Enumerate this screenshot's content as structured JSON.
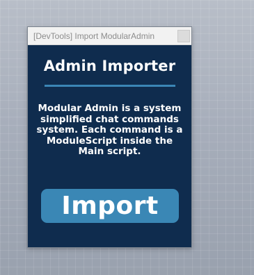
{
  "window": {
    "title": "[DevTools] Import ModularAdmin"
  },
  "plugin": {
    "heading": "Admin Importer",
    "description": "Modular Admin is a system simplified chat commands system. Each command is a ModuleScript inside the Main script.",
    "import_label": "Import"
  },
  "colors": {
    "panel_background": "#0f2c4e",
    "accent": "#3a87b5",
    "divider": "#3b86b6"
  }
}
